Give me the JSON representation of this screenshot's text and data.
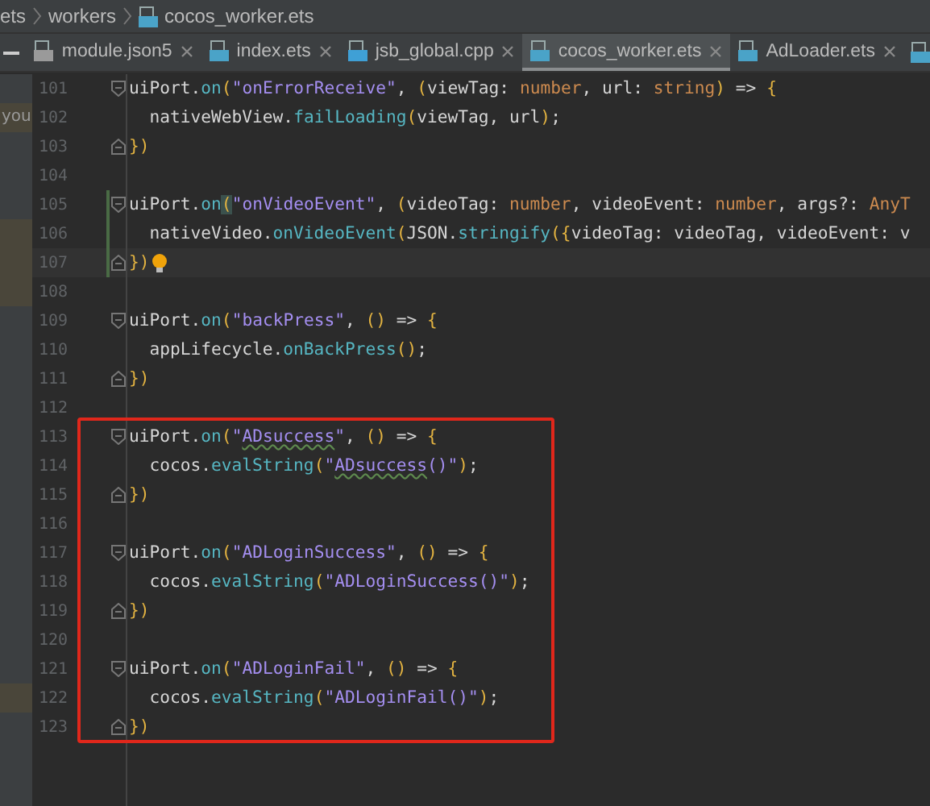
{
  "breadcrumb": [
    {
      "label": "ets",
      "icon": false
    },
    {
      "label": "workers",
      "icon": false
    },
    {
      "label": "cocos_worker.ets",
      "icon": true
    }
  ],
  "tabs": [
    {
      "label": "module.json5",
      "kind": "config",
      "selected": false
    },
    {
      "label": "index.ets",
      "kind": "ets",
      "selected": false
    },
    {
      "label": "jsb_global.cpp",
      "kind": "cpp",
      "selected": false
    },
    {
      "label": "cocos_worker.ets",
      "kind": "ets",
      "selected": true
    },
    {
      "label": "AdLoader.ets",
      "kind": "ets",
      "selected": false
    }
  ],
  "side_panel": {
    "text": "you"
  },
  "sections": [
    {
      "lines": [
        {
          "number": "101",
          "fold_start": true,
          "tokens": [
            {
              "text": "uiPort.",
              "kind": "plain"
            },
            {
              "text": "on",
              "kind": "member"
            },
            {
              "text": "(",
              "kind": "bracket"
            },
            {
              "text": "\"onErrorReceive\"",
              "kind": "string"
            },
            {
              "text": ", ",
              "kind": "plain"
            },
            {
              "text": "(",
              "kind": "bracket"
            },
            {
              "text": "viewTag: ",
              "kind": "plain"
            },
            {
              "text": "number",
              "kind": "type"
            },
            {
              "text": ", url: ",
              "kind": "plain"
            },
            {
              "text": "string",
              "kind": "type"
            },
            {
              "text": ")",
              "kind": "bracket"
            },
            {
              "text": " => ",
              "kind": "plain"
            },
            {
              "text": "{",
              "kind": "bracket"
            }
          ]
        },
        {
          "number": "102",
          "side_mark": true,
          "tokens": [
            {
              "text": "  nativeWebView.",
              "kind": "plain"
            },
            {
              "text": "failLoading",
              "kind": "member"
            },
            {
              "text": "(",
              "kind": "bracket"
            },
            {
              "text": "viewTag, url",
              "kind": "plain"
            },
            {
              "text": ")",
              "kind": "bracket"
            },
            {
              "text": ";",
              "kind": "plain"
            }
          ]
        },
        {
          "number": "103",
          "fold_end": true,
          "tokens": [
            {
              "text": "})",
              "kind": "bracket"
            }
          ]
        },
        {
          "number": "104"
        },
        {
          "number": "105",
          "fold_start": true,
          "changed": true,
          "tokens": [
            {
              "text": "uiPort.",
              "kind": "plain"
            },
            {
              "text": "on",
              "kind": "member"
            },
            {
              "text": "(",
              "kind": "match"
            },
            {
              "text": "\"onVideoEvent\"",
              "kind": "string"
            },
            {
              "text": ", ",
              "kind": "plain"
            },
            {
              "text": "(",
              "kind": "bracket"
            },
            {
              "text": "videoTag: ",
              "kind": "plain"
            },
            {
              "text": "number",
              "kind": "type"
            },
            {
              "text": ", videoEvent: ",
              "kind": "plain"
            },
            {
              "text": "number",
              "kind": "type"
            },
            {
              "text": ", args?: ",
              "kind": "plain"
            },
            {
              "text": "AnyT",
              "kind": "type"
            }
          ]
        },
        {
          "number": "106",
          "changed": true,
          "side_mark": true,
          "tokens": [
            {
              "text": "  nativeVideo.",
              "kind": "plain"
            },
            {
              "text": "onVideoEvent",
              "kind": "member"
            },
            {
              "text": "(",
              "kind": "bracket"
            },
            {
              "text": "JSON.",
              "kind": "plain"
            },
            {
              "text": "stringify",
              "kind": "member"
            },
            {
              "text": "(",
              "kind": "bracket"
            },
            {
              "text": "{",
              "kind": "bracket"
            },
            {
              "text": "videoTag: videoTag, videoEvent: v",
              "kind": "plain"
            }
          ]
        },
        {
          "number": "107",
          "fold_end": true,
          "changed": true,
          "current": true,
          "side_mark": true,
          "bulb": true,
          "tokens": [
            {
              "text": "}",
              "kind": "bracket"
            },
            {
              "text": ")",
              "kind": "bracket"
            }
          ]
        },
        {
          "number": "108",
          "side_mark": true
        },
        {
          "number": "109",
          "fold_start": true,
          "tokens": [
            {
              "text": "uiPort.",
              "kind": "plain"
            },
            {
              "text": "on",
              "kind": "member"
            },
            {
              "text": "(",
              "kind": "bracket"
            },
            {
              "text": "\"backPress\"",
              "kind": "string"
            },
            {
              "text": ", ",
              "kind": "plain"
            },
            {
              "text": "()",
              "kind": "bracket"
            },
            {
              "text": " => ",
              "kind": "plain"
            },
            {
              "text": "{",
              "kind": "bracket"
            }
          ]
        },
        {
          "number": "110",
          "tokens": [
            {
              "text": "  appLifecycle.",
              "kind": "plain"
            },
            {
              "text": "onBackPress",
              "kind": "member"
            },
            {
              "text": "()",
              "kind": "bracket"
            },
            {
              "text": ";",
              "kind": "plain"
            }
          ]
        },
        {
          "number": "111",
          "fold_end": true,
          "tokens": [
            {
              "text": "})",
              "kind": "bracket"
            }
          ]
        },
        {
          "number": "112"
        }
      ]
    },
    {
      "boxed": true,
      "lines": [
        {
          "number": "113",
          "fold_start": true,
          "tokens": [
            {
              "text": "uiPort.",
              "kind": "plain"
            },
            {
              "text": "on",
              "kind": "member"
            },
            {
              "text": "(",
              "kind": "bracket"
            },
            {
              "text": "\"",
              "kind": "string"
            },
            {
              "text": "ADsuccess",
              "kind": "typo"
            },
            {
              "text": "\"",
              "kind": "string"
            },
            {
              "text": ", ",
              "kind": "plain"
            },
            {
              "text": "()",
              "kind": "bracket"
            },
            {
              "text": " => ",
              "kind": "plain"
            },
            {
              "text": "{",
              "kind": "bracket"
            }
          ]
        },
        {
          "number": "114",
          "tokens": [
            {
              "text": "  cocos.",
              "kind": "plain"
            },
            {
              "text": "evalString",
              "kind": "member"
            },
            {
              "text": "(",
              "kind": "bracket"
            },
            {
              "text": "\"",
              "kind": "string"
            },
            {
              "text": "ADsuccess",
              "kind": "typo"
            },
            {
              "text": "()\"",
              "kind": "string"
            },
            {
              "text": ")",
              "kind": "bracket"
            },
            {
              "text": ";",
              "kind": "plain"
            }
          ]
        },
        {
          "number": "115",
          "fold_end": true,
          "tokens": [
            {
              "text": "})",
              "kind": "bracket"
            }
          ]
        },
        {
          "number": "116"
        },
        {
          "number": "117",
          "fold_start": true,
          "tokens": [
            {
              "text": "uiPort.",
              "kind": "plain"
            },
            {
              "text": "on",
              "kind": "member"
            },
            {
              "text": "(",
              "kind": "bracket"
            },
            {
              "text": "\"ADLoginSuccess\"",
              "kind": "string"
            },
            {
              "text": ", ",
              "kind": "plain"
            },
            {
              "text": "()",
              "kind": "bracket"
            },
            {
              "text": " => ",
              "kind": "plain"
            },
            {
              "text": "{",
              "kind": "bracket"
            }
          ]
        },
        {
          "number": "118",
          "tokens": [
            {
              "text": "  cocos.",
              "kind": "plain"
            },
            {
              "text": "evalString",
              "kind": "member"
            },
            {
              "text": "(",
              "kind": "bracket"
            },
            {
              "text": "\"ADLoginSuccess()\"",
              "kind": "string"
            },
            {
              "text": ")",
              "kind": "bracket"
            },
            {
              "text": ";",
              "kind": "plain"
            }
          ]
        },
        {
          "number": "119",
          "fold_end": true,
          "tokens": [
            {
              "text": "})",
              "kind": "bracket"
            }
          ]
        },
        {
          "number": "120"
        },
        {
          "number": "121",
          "fold_start": true,
          "tokens": [
            {
              "text": "uiPort.",
              "kind": "plain"
            },
            {
              "text": "on",
              "kind": "member"
            },
            {
              "text": "(",
              "kind": "bracket"
            },
            {
              "text": "\"ADLoginFail\"",
              "kind": "string"
            },
            {
              "text": ", ",
              "kind": "plain"
            },
            {
              "text": "()",
              "kind": "bracket"
            },
            {
              "text": " => ",
              "kind": "plain"
            },
            {
              "text": "{",
              "kind": "bracket"
            }
          ]
        },
        {
          "number": "122",
          "side_mark": true,
          "tokens": [
            {
              "text": "  cocos.",
              "kind": "plain"
            },
            {
              "text": "evalString",
              "kind": "member"
            },
            {
              "text": "(",
              "kind": "bracket"
            },
            {
              "text": "\"ADLoginFail()\"",
              "kind": "string"
            },
            {
              "text": ")",
              "kind": "bracket"
            },
            {
              "text": ";",
              "kind": "plain"
            }
          ]
        },
        {
          "number": "123",
          "fold_end": true,
          "tokens": [
            {
              "text": "})",
              "kind": "bracket"
            }
          ]
        }
      ]
    }
  ]
}
